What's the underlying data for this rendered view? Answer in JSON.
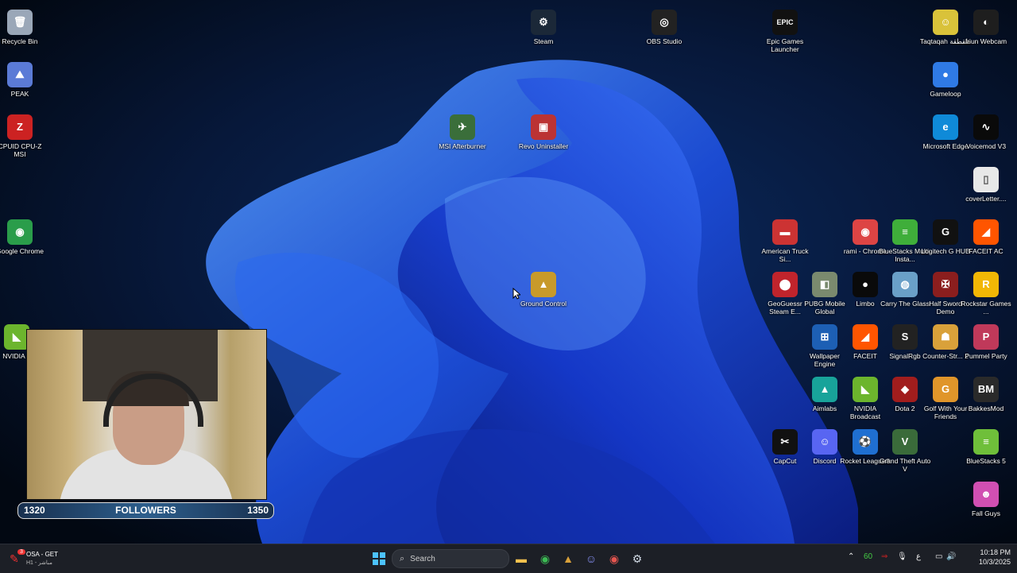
{
  "desktop_icons": [
    {
      "id": "recycle-bin",
      "label": "Recycle Bin",
      "glyph": "🗑",
      "color": "#9aa7b8"
    },
    {
      "id": "peak",
      "label": "PEAK",
      "glyph": "⛰",
      "color": "#5b7bd6"
    },
    {
      "id": "cpuz",
      "label": "CPUID CPU-Z MSI",
      "glyph": "Z",
      "color": "#c22"
    },
    {
      "id": "google-chrome",
      "label": "Google Chrome",
      "glyph": "◉",
      "color": "#2a9d4a"
    },
    {
      "id": "nvidia",
      "label": "NVIDIA A",
      "glyph": "◣",
      "color": "#6cb52d"
    },
    {
      "id": "steam",
      "label": "Steam",
      "glyph": "⚙",
      "color": "#1b2838"
    },
    {
      "id": "obs",
      "label": "OBS Studio",
      "glyph": "◎",
      "color": "#222"
    },
    {
      "id": "epic",
      "label": "Epic Games Launcher",
      "glyph": "EPIC",
      "color": "#111"
    },
    {
      "id": "taqtaqah",
      "label": "Taqtaqah طقطقة",
      "glyph": "☺",
      "color": "#d9c23a"
    },
    {
      "id": "iriun",
      "label": "Iriun Webcam",
      "glyph": "◐",
      "color": "#1e1e1e"
    },
    {
      "id": "gameloop",
      "label": "Gameloop",
      "glyph": "●",
      "color": "#2f7ae5"
    },
    {
      "id": "msi-afterburner",
      "label": "MSI Afterburner",
      "glyph": "✈",
      "color": "#3a6e3a"
    },
    {
      "id": "revo",
      "label": "Revo Uninstaller",
      "glyph": "▣",
      "color": "#b33"
    },
    {
      "id": "edge",
      "label": "Microsoft Edge",
      "glyph": "e",
      "color": "#0f8ad8"
    },
    {
      "id": "voicemod",
      "label": "Voicemod V3",
      "glyph": "∿",
      "color": "#0a0a0a"
    },
    {
      "id": "cover-letter",
      "label": "coverLetter....",
      "glyph": "▯",
      "color": "#e8e8e8"
    },
    {
      "id": "ground-control",
      "label": "Ground Control",
      "glyph": "▲",
      "color": "#c89a2a"
    },
    {
      "id": "american-truck",
      "label": "American Truck Si...",
      "glyph": "▬",
      "color": "#c33"
    },
    {
      "id": "rami-chrome",
      "label": "rami - Chrome",
      "glyph": "◉",
      "color": "#d44"
    },
    {
      "id": "bluestacks-multi",
      "label": "BlueStacks Multi-Insta...",
      "glyph": "≡",
      "color": "#3fae3a"
    },
    {
      "id": "logitech",
      "label": "Logitech G HUB",
      "glyph": "G",
      "color": "#111"
    },
    {
      "id": "faceit-ac",
      "label": "FACEIT AC",
      "glyph": "◢",
      "color": "#ff5500"
    },
    {
      "id": "geoguessr",
      "label": "GeoGuessr Steam E...",
      "glyph": "⬤",
      "color": "#c0242c"
    },
    {
      "id": "pubg",
      "label": "PUBG Mobile Global",
      "glyph": "◧",
      "color": "#7a8a6e"
    },
    {
      "id": "limbo",
      "label": "Limbo",
      "glyph": "●",
      "color": "#0a0a0a"
    },
    {
      "id": "carry-glass",
      "label": "Carry The Glass",
      "glyph": "◍",
      "color": "#6aa0c8"
    },
    {
      "id": "half-sword",
      "label": "Half Sword Demo",
      "glyph": "✠",
      "color": "#8b1e1e"
    },
    {
      "id": "rockstar",
      "label": "Rockstar Games ...",
      "glyph": "R",
      "color": "#f2b705"
    },
    {
      "id": "wallpaper-engine",
      "label": "Wallpaper Engine",
      "glyph": "⊞",
      "color": "#1d5fb4"
    },
    {
      "id": "faceit",
      "label": "FACEIT",
      "glyph": "◢",
      "color": "#ff5500"
    },
    {
      "id": "signalrgb",
      "label": "SignalRgb",
      "glyph": "S",
      "color": "#222"
    },
    {
      "id": "counter-strike",
      "label": "Counter-Str... 2",
      "glyph": "☗",
      "color": "#d9a13a"
    },
    {
      "id": "pummel",
      "label": "Pummel Party",
      "glyph": "P",
      "color": "#c0395a"
    },
    {
      "id": "aimlabs",
      "label": "Aimlabs",
      "glyph": "▲",
      "color": "#18a39a"
    },
    {
      "id": "nvidia-broadcast",
      "label": "NVIDIA Broadcast",
      "glyph": "◣",
      "color": "#6cb52d"
    },
    {
      "id": "dota2",
      "label": "Dota 2",
      "glyph": "◆",
      "color": "#a11d1d"
    },
    {
      "id": "golf",
      "label": "Golf With Your Friends",
      "glyph": "G",
      "color": "#e0952a"
    },
    {
      "id": "bakkesmod",
      "label": "BakkesMod",
      "glyph": "BM",
      "color": "#2a2a2a"
    },
    {
      "id": "capcut",
      "label": "CapCut",
      "glyph": "✂",
      "color": "#111"
    },
    {
      "id": "discord",
      "label": "Discord",
      "glyph": "☺",
      "color": "#5865f2"
    },
    {
      "id": "rocket-league",
      "label": "Rocket League®",
      "glyph": "⚽",
      "color": "#1f6fd1"
    },
    {
      "id": "gta5",
      "label": "Grand Theft Auto V",
      "glyph": "V",
      "color": "#3a6b3a"
    },
    {
      "id": "bluestacks5",
      "label": "BlueStacks 5",
      "glyph": "≡",
      "color": "#6fbf3a"
    },
    {
      "id": "fall-guys",
      "label": "Fall Guys",
      "glyph": "☻",
      "color": "#d14fb2"
    }
  ],
  "followers_bar": {
    "current": "1320",
    "label": "FOLLOWERS",
    "goal": "1350",
    "progress_fraction": 0.0
  },
  "taskbar": {
    "notification": {
      "badge": "3",
      "title": "OSA - GET",
      "subtitle": "H1 - مباشر"
    },
    "search_placeholder": "Search",
    "pinned": [
      "file-explorer-icon",
      "chrome-icon",
      "ground-control-icon",
      "discord-icon",
      "chrome-2-icon",
      "steam-icon"
    ],
    "tray": {
      "fps": "60",
      "lang": "ع",
      "time": "10:18 PM",
      "date": "10/3/2025"
    }
  }
}
